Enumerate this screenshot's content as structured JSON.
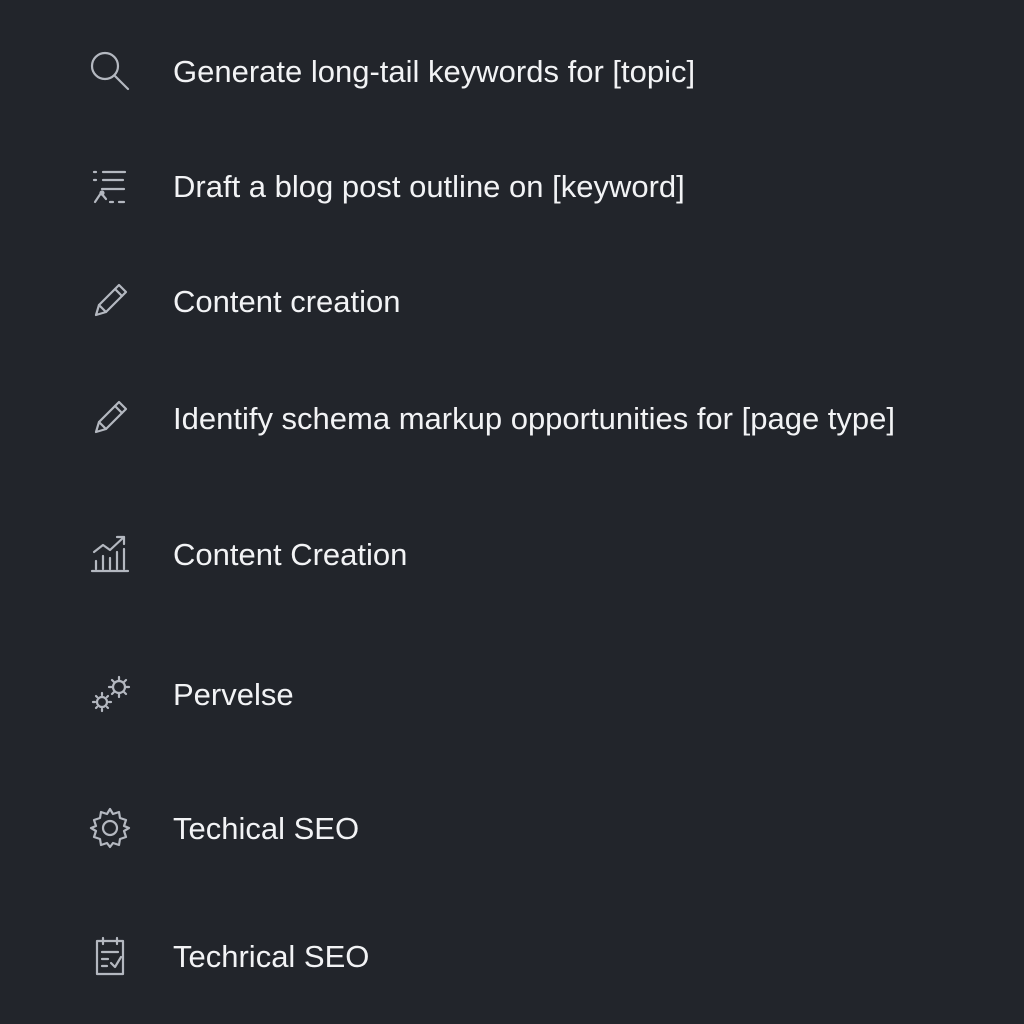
{
  "menu": {
    "items": [
      {
        "label": "Generate long-tail keywords for [topic]",
        "icon": "search-icon"
      },
      {
        "label": "Draft a blog post outline on [keyword]",
        "icon": "outline-icon"
      },
      {
        "label": "Content creation",
        "icon": "pencil-icon"
      },
      {
        "label": "Identify schema markup opportunities for [page type]",
        "icon": "pencil-icon"
      },
      {
        "label": "Content Creation",
        "icon": "growth-chart-icon"
      },
      {
        "label": "Pervelse",
        "icon": "gears-icon"
      },
      {
        "label": "Techical SEO",
        "icon": "gear-icon"
      },
      {
        "label": "Techrical SEO",
        "icon": "checklist-icon"
      }
    ]
  },
  "colors": {
    "background": "#22252b",
    "text": "#f2f3f5",
    "icon": "#b4b8c0"
  }
}
